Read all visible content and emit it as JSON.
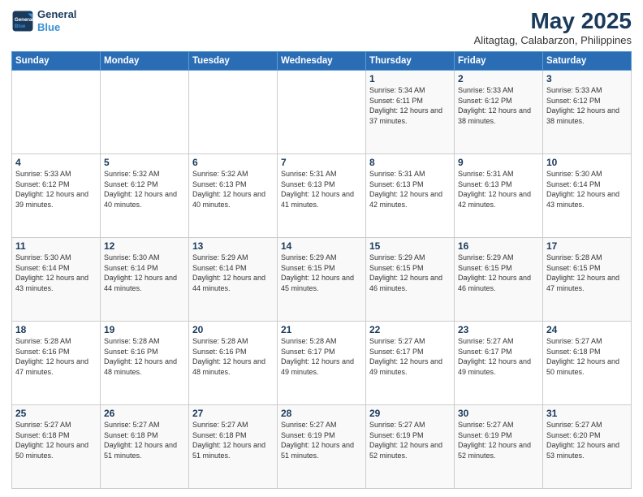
{
  "logo": {
    "line1": "General",
    "line2": "Blue"
  },
  "title": "May 2025",
  "subtitle": "Alitagtag, Calabarzon, Philippines",
  "weekdays": [
    "Sunday",
    "Monday",
    "Tuesday",
    "Wednesday",
    "Thursday",
    "Friday",
    "Saturday"
  ],
  "weeks": [
    [
      {
        "day": "",
        "sunrise": "",
        "sunset": "",
        "daylight": ""
      },
      {
        "day": "",
        "sunrise": "",
        "sunset": "",
        "daylight": ""
      },
      {
        "day": "",
        "sunrise": "",
        "sunset": "",
        "daylight": ""
      },
      {
        "day": "",
        "sunrise": "",
        "sunset": "",
        "daylight": ""
      },
      {
        "day": "1",
        "sunrise": "Sunrise: 5:34 AM",
        "sunset": "Sunset: 6:11 PM",
        "daylight": "Daylight: 12 hours and 37 minutes."
      },
      {
        "day": "2",
        "sunrise": "Sunrise: 5:33 AM",
        "sunset": "Sunset: 6:12 PM",
        "daylight": "Daylight: 12 hours and 38 minutes."
      },
      {
        "day": "3",
        "sunrise": "Sunrise: 5:33 AM",
        "sunset": "Sunset: 6:12 PM",
        "daylight": "Daylight: 12 hours and 38 minutes."
      }
    ],
    [
      {
        "day": "4",
        "sunrise": "Sunrise: 5:33 AM",
        "sunset": "Sunset: 6:12 PM",
        "daylight": "Daylight: 12 hours and 39 minutes."
      },
      {
        "day": "5",
        "sunrise": "Sunrise: 5:32 AM",
        "sunset": "Sunset: 6:12 PM",
        "daylight": "Daylight: 12 hours and 40 minutes."
      },
      {
        "day": "6",
        "sunrise": "Sunrise: 5:32 AM",
        "sunset": "Sunset: 6:13 PM",
        "daylight": "Daylight: 12 hours and 40 minutes."
      },
      {
        "day": "7",
        "sunrise": "Sunrise: 5:31 AM",
        "sunset": "Sunset: 6:13 PM",
        "daylight": "Daylight: 12 hours and 41 minutes."
      },
      {
        "day": "8",
        "sunrise": "Sunrise: 5:31 AM",
        "sunset": "Sunset: 6:13 PM",
        "daylight": "Daylight: 12 hours and 42 minutes."
      },
      {
        "day": "9",
        "sunrise": "Sunrise: 5:31 AM",
        "sunset": "Sunset: 6:13 PM",
        "daylight": "Daylight: 12 hours and 42 minutes."
      },
      {
        "day": "10",
        "sunrise": "Sunrise: 5:30 AM",
        "sunset": "Sunset: 6:14 PM",
        "daylight": "Daylight: 12 hours and 43 minutes."
      }
    ],
    [
      {
        "day": "11",
        "sunrise": "Sunrise: 5:30 AM",
        "sunset": "Sunset: 6:14 PM",
        "daylight": "Daylight: 12 hours and 43 minutes."
      },
      {
        "day": "12",
        "sunrise": "Sunrise: 5:30 AM",
        "sunset": "Sunset: 6:14 PM",
        "daylight": "Daylight: 12 hours and 44 minutes."
      },
      {
        "day": "13",
        "sunrise": "Sunrise: 5:29 AM",
        "sunset": "Sunset: 6:14 PM",
        "daylight": "Daylight: 12 hours and 44 minutes."
      },
      {
        "day": "14",
        "sunrise": "Sunrise: 5:29 AM",
        "sunset": "Sunset: 6:15 PM",
        "daylight": "Daylight: 12 hours and 45 minutes."
      },
      {
        "day": "15",
        "sunrise": "Sunrise: 5:29 AM",
        "sunset": "Sunset: 6:15 PM",
        "daylight": "Daylight: 12 hours and 46 minutes."
      },
      {
        "day": "16",
        "sunrise": "Sunrise: 5:29 AM",
        "sunset": "Sunset: 6:15 PM",
        "daylight": "Daylight: 12 hours and 46 minutes."
      },
      {
        "day": "17",
        "sunrise": "Sunrise: 5:28 AM",
        "sunset": "Sunset: 6:15 PM",
        "daylight": "Daylight: 12 hours and 47 minutes."
      }
    ],
    [
      {
        "day": "18",
        "sunrise": "Sunrise: 5:28 AM",
        "sunset": "Sunset: 6:16 PM",
        "daylight": "Daylight: 12 hours and 47 minutes."
      },
      {
        "day": "19",
        "sunrise": "Sunrise: 5:28 AM",
        "sunset": "Sunset: 6:16 PM",
        "daylight": "Daylight: 12 hours and 48 minutes."
      },
      {
        "day": "20",
        "sunrise": "Sunrise: 5:28 AM",
        "sunset": "Sunset: 6:16 PM",
        "daylight": "Daylight: 12 hours and 48 minutes."
      },
      {
        "day": "21",
        "sunrise": "Sunrise: 5:28 AM",
        "sunset": "Sunset: 6:17 PM",
        "daylight": "Daylight: 12 hours and 49 minutes."
      },
      {
        "day": "22",
        "sunrise": "Sunrise: 5:27 AM",
        "sunset": "Sunset: 6:17 PM",
        "daylight": "Daylight: 12 hours and 49 minutes."
      },
      {
        "day": "23",
        "sunrise": "Sunrise: 5:27 AM",
        "sunset": "Sunset: 6:17 PM",
        "daylight": "Daylight: 12 hours and 49 minutes."
      },
      {
        "day": "24",
        "sunrise": "Sunrise: 5:27 AM",
        "sunset": "Sunset: 6:18 PM",
        "daylight": "Daylight: 12 hours and 50 minutes."
      }
    ],
    [
      {
        "day": "25",
        "sunrise": "Sunrise: 5:27 AM",
        "sunset": "Sunset: 6:18 PM",
        "daylight": "Daylight: 12 hours and 50 minutes."
      },
      {
        "day": "26",
        "sunrise": "Sunrise: 5:27 AM",
        "sunset": "Sunset: 6:18 PM",
        "daylight": "Daylight: 12 hours and 51 minutes."
      },
      {
        "day": "27",
        "sunrise": "Sunrise: 5:27 AM",
        "sunset": "Sunset: 6:18 PM",
        "daylight": "Daylight: 12 hours and 51 minutes."
      },
      {
        "day": "28",
        "sunrise": "Sunrise: 5:27 AM",
        "sunset": "Sunset: 6:19 PM",
        "daylight": "Daylight: 12 hours and 51 minutes."
      },
      {
        "day": "29",
        "sunrise": "Sunrise: 5:27 AM",
        "sunset": "Sunset: 6:19 PM",
        "daylight": "Daylight: 12 hours and 52 minutes."
      },
      {
        "day": "30",
        "sunrise": "Sunrise: 5:27 AM",
        "sunset": "Sunset: 6:19 PM",
        "daylight": "Daylight: 12 hours and 52 minutes."
      },
      {
        "day": "31",
        "sunrise": "Sunrise: 5:27 AM",
        "sunset": "Sunset: 6:20 PM",
        "daylight": "Daylight: 12 hours and 53 minutes."
      }
    ]
  ]
}
